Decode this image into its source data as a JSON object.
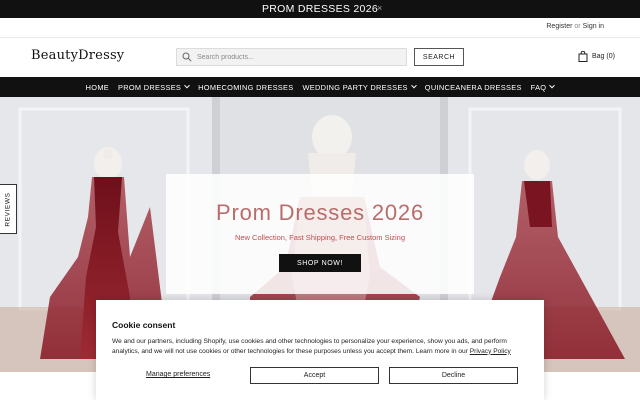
{
  "announcement": {
    "text": "PROM DRESSES 2026",
    "close": "×"
  },
  "account": {
    "register": "Register",
    "or": "or",
    "sign_in": "Sign in"
  },
  "header": {
    "logo": "BeautyDressy",
    "search_placeholder": "Search products...",
    "search_button": "SEARCH",
    "bag": "Bag (0)"
  },
  "nav": {
    "items": [
      {
        "label": "HOME",
        "has_dropdown": false
      },
      {
        "label": "PROM DRESSES",
        "has_dropdown": true
      },
      {
        "label": "HOMECOMING DRESSES",
        "has_dropdown": false
      },
      {
        "label": "WEDDING PARTY DRESSES",
        "has_dropdown": true
      },
      {
        "label": "QUINCEANERA DRESSES",
        "has_dropdown": false
      },
      {
        "label": "FAQ",
        "has_dropdown": true
      }
    ]
  },
  "hero": {
    "title": "Prom Dresses 2026",
    "subtitle": "New Collection, Fast Shipping, Free Custom Sizing",
    "button": "SHOP NOW!"
  },
  "reviews_tab": "REVIEWS",
  "cookie": {
    "title": "Cookie consent",
    "text": "We and our partners, including Shopify, use cookies and other technologies to personalize your experience, show you ads, and perform analytics, and we will not use cookies or other technologies for these purposes unless you accept them. Learn more in our",
    "policy_link": "Privacy Policy",
    "manage": "Manage preferences",
    "accept": "Accept",
    "decline": "Decline"
  },
  "colors": {
    "bar": "#111111",
    "hero_title": "#b96d6a",
    "hero_subtitle": "#c0504d",
    "dress": "#8b1a24"
  }
}
